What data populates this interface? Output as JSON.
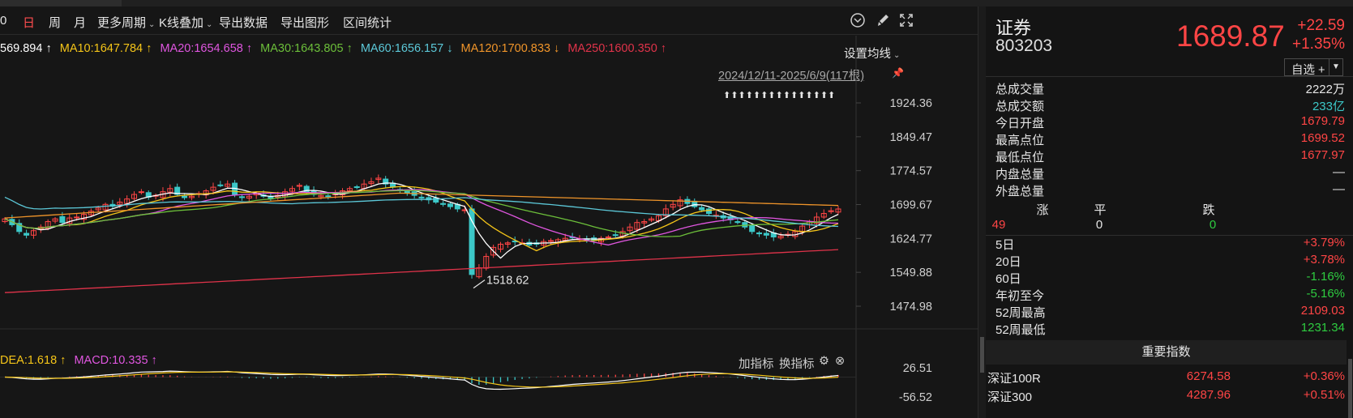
{
  "toolbar": {
    "partial_tab": "0",
    "day": "日",
    "week": "周",
    "month": "月",
    "more_periods": "更多周期",
    "kline_overlay": "K线叠加",
    "export_data": "导出数据",
    "export_chart": "导出图形",
    "range_stats": "区间统计"
  },
  "ma": {
    "ma5": "569.894 ↑",
    "ma10": "MA10:1647.784 ↑",
    "ma20": "MA20:1654.658 ↑",
    "ma30": "MA30:1643.805 ↑",
    "ma60": "MA60:1656.157 ↓",
    "ma120": "MA120:1700.833 ↓",
    "ma250": "MA250:1600.350 ↑",
    "settings": "设置均线",
    "range": "2024/12/11-2025/6/9(117根)",
    "arrows": "⬆⬆⬆⬆⬆⬆⬆⬆⬆⬆⬆⬆⬆⬆⬆"
  },
  "axis": {
    "y_labels": [
      "1924.36",
      "1849.47",
      "1774.57",
      "1699.67",
      "1624.77",
      "1549.88",
      "1474.98"
    ],
    "low_mark": "1518.62",
    "macd_top": "26.51",
    "macd_bottom": "-56.52"
  },
  "macd": {
    "dea": "DEA:1.618 ↑",
    "macd": "MACD:10.335 ↑",
    "add_indicator": "加指标",
    "switch_indicator": "换指标"
  },
  "colors": {
    "up": "#ff4545",
    "down": "#3cc8c8",
    "ma5": "#ffffff",
    "ma10": "#f5c518",
    "ma20": "#e056e0",
    "ma30": "#6cbf3a",
    "ma60": "#5cc8d8",
    "ma120": "#f0952a",
    "ma250": "#e0334a"
  },
  "quote": {
    "name": "证券",
    "code": "803203",
    "price": "1689.87",
    "change": "+22.59",
    "change_pct": "+1.35%",
    "fav": "自选 +",
    "stats": [
      {
        "k": "总成交量",
        "v": "2222万",
        "c": "white"
      },
      {
        "k": "总成交额",
        "v": "233亿",
        "c": "cyan"
      },
      {
        "k": "今日开盘",
        "v": "1679.79",
        "c": "red"
      },
      {
        "k": "最高点位",
        "v": "1699.52",
        "c": "red"
      },
      {
        "k": "最低点位",
        "v": "1677.97",
        "c": "red"
      },
      {
        "k": "内盘总量",
        "v": "—",
        "c": "white"
      },
      {
        "k": "外盘总量",
        "v": "—",
        "c": "white"
      }
    ],
    "breadth": {
      "up_label": "涨",
      "flat_label": "平",
      "down_label": "跌",
      "up": "49",
      "flat": "0",
      "down": "0"
    },
    "perf": [
      {
        "k": "5日",
        "v": "+3.79%",
        "c": "red"
      },
      {
        "k": "20日",
        "v": "+3.78%",
        "c": "red"
      },
      {
        "k": "60日",
        "v": "-1.16%",
        "c": "green"
      },
      {
        "k": "年初至今",
        "v": "-5.16%",
        "c": "green"
      },
      {
        "k": "52周最高",
        "v": "2109.03",
        "c": "red"
      },
      {
        "k": "52周最低",
        "v": "1231.34",
        "c": "green"
      }
    ]
  },
  "indices": {
    "title": "重要指数",
    "rows": [
      {
        "name": "深证100R",
        "price": "6274.58",
        "chg": "+0.36%"
      },
      {
        "name": "深证300",
        "price": "4287.96",
        "chg": "+0.51%"
      }
    ]
  },
  "chart_data": {
    "type": "candlestick",
    "period": "日",
    "range": "2024/12/11-2025/6/9",
    "bars": 117,
    "y_range": [
      1474.98,
      1924.36
    ],
    "low_marker": 1518.62,
    "last": {
      "open": 1679.79,
      "high": 1699.52,
      "low": 1677.97,
      "close": 1689.87
    },
    "ma_last": {
      "MA10": 1647.784,
      "MA20": 1654.658,
      "MA30": 1643.805,
      "MA60": 1656.157,
      "MA120": 1700.833,
      "MA250": 1600.35
    },
    "macd_range": [
      -56.52,
      26.51
    ],
    "close_approx": [
      1668,
      1655,
      1640,
      1632,
      1642,
      1650,
      1662,
      1668,
      1660,
      1670,
      1672,
      1678,
      1685,
      1692,
      1700,
      1696,
      1705,
      1712,
      1722,
      1728,
      1716,
      1720,
      1728,
      1735,
      1722,
      1715,
      1718,
      1724,
      1730,
      1738,
      1742,
      1745,
      1722,
      1715,
      1718,
      1725,
      1718,
      1712,
      1720,
      1728,
      1735,
      1742,
      1728,
      1722,
      1720,
      1718,
      1725,
      1730,
      1735,
      1738,
      1745,
      1750,
      1758,
      1745,
      1738,
      1730,
      1725,
      1720,
      1715,
      1710,
      1705,
      1700,
      1695,
      1690,
      1688,
      1545,
      1560,
      1585,
      1605,
      1612,
      1615,
      1618,
      1615,
      1610,
      1612,
      1618,
      1620,
      1622,
      1625,
      1626,
      1624,
      1622,
      1620,
      1625,
      1628,
      1632,
      1640,
      1650,
      1660,
      1662,
      1668,
      1675,
      1690,
      1700,
      1710,
      1702,
      1695,
      1688,
      1680,
      1676,
      1670,
      1666,
      1660,
      1650,
      1640,
      1635,
      1632,
      1628,
      1630,
      1634,
      1640,
      1652,
      1662,
      1672,
      1680,
      1686,
      1689.87
    ]
  }
}
